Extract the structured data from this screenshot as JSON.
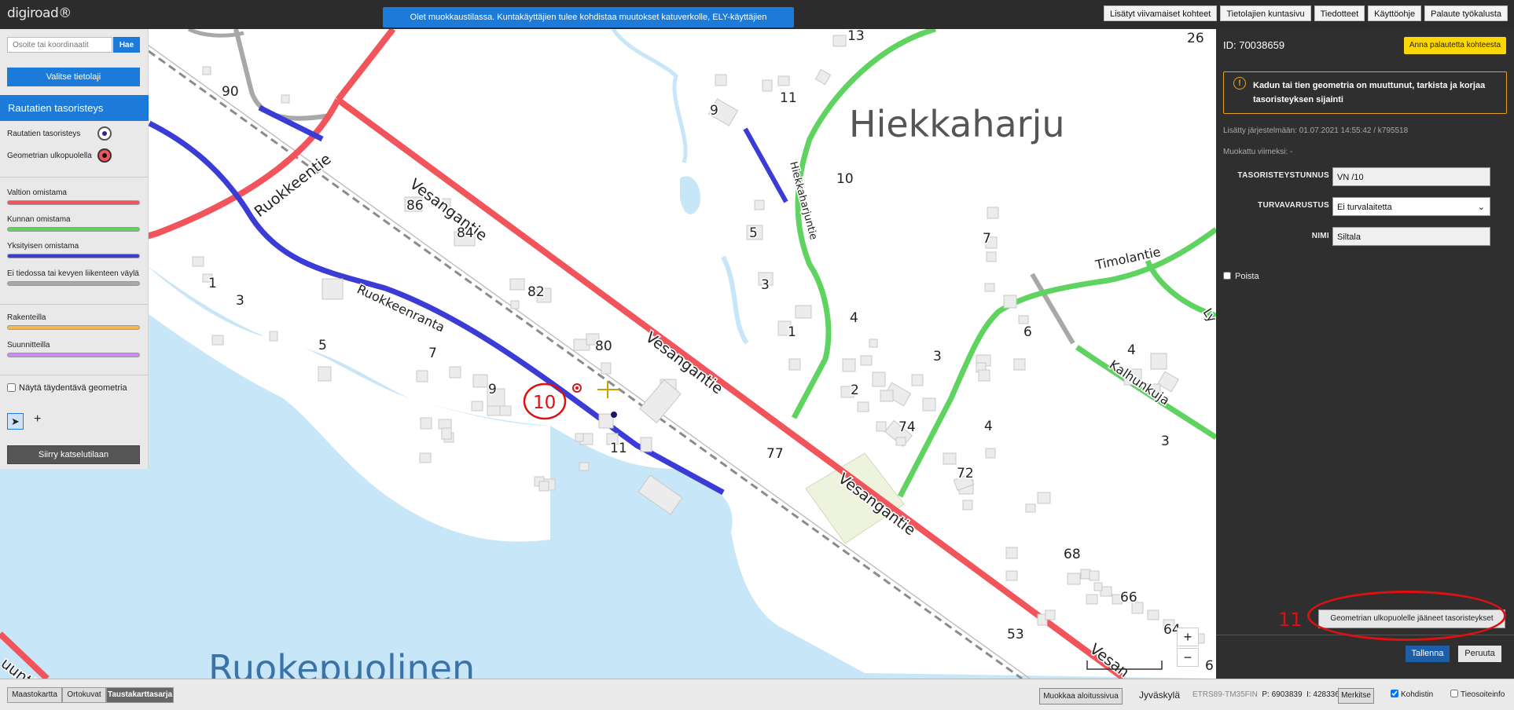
{
  "topbar": {
    "logo": "digiroad®",
    "banner": "Olet muokkaustilassa. Kuntakäyttäjien tulee kohdistaa muutokset katuverkolle, ELY-käyttäjien maantieverkolle.",
    "buttons": [
      "Lisätyt viivamaiset kohteet",
      "Tietolajien kuntasivu",
      "Tiedotteet",
      "Käyttöohje",
      "Palaute työkalusta"
    ]
  },
  "left_panel": {
    "search_placeholder": "Osoite tai koordinaatit",
    "search_button": "Hae",
    "select_layer_button": "Valitse tietolaji",
    "layer_title": "Rautatien tasoristeys",
    "legend_points": [
      {
        "label": "Rautatien tasoristeys",
        "color": "#2a2a8a"
      },
      {
        "label": "Geometrian ulkopuolella",
        "color": "#d41a1a"
      }
    ],
    "legend_lines": [
      {
        "label": "Valtion omistama",
        "color": "#f2545b"
      },
      {
        "label": "Kunnan omistama",
        "color": "#5fd35f"
      },
      {
        "label": "Yksityisen omistama",
        "color": "#3b3bd6"
      },
      {
        "label": "Ei tiedossa tai kevyen liikenteen väylä",
        "color": "#a8a8a8"
      },
      {
        "label": "Rakenteilla",
        "color": "#f6b84a"
      },
      {
        "label": "Suunnitteilla",
        "color": "#c88ef0"
      }
    ],
    "show_geometry_label": "Näytä täydentävä geometria",
    "view_mode_button": "Siirry katselutilaan"
  },
  "map": {
    "place_labels": {
      "hiekkaharju": "Hiekkaharju",
      "ruokepuolinen": "Ruokepuolinen"
    },
    "road_labels": {
      "vesangantie_1": "Vesangantie",
      "vesangantie_2": "Vesangantie",
      "vesangantie_3": "Vesangantie",
      "vesangantie_4": "Vesan",
      "ruokkeentie": "Ruokkeentie",
      "ruokkeenranta": "Ruokkeenranta",
      "hiekkaharjuntie": "Hiekkaharjuntie",
      "timolantie": "Timolantie",
      "kalhunkuja": "Kalhunkuja",
      "ly": "Ly",
      "uuntie": "uuntie"
    },
    "house_numbers": {
      "n13": "13",
      "n26": "26",
      "n90": "90",
      "n9a": "9",
      "n11a": "11",
      "n10a": "10",
      "n86": "86",
      "n84": "84",
      "n5a": "5",
      "n7a": "7",
      "n1a": "1",
      "n3a": "3",
      "n82": "82",
      "n3b": "3",
      "n5b": "5",
      "n7b": "7",
      "n80": "80",
      "n4a": "4",
      "n1b": "1",
      "n6": "6",
      "n4b": "4",
      "n3c": "3",
      "n9b": "9",
      "n2": "2",
      "n74": "74",
      "n4c": "4",
      "n3d": "3",
      "n11b": "11",
      "n77": "77",
      "n72": "72",
      "n68": "68",
      "n66": "66",
      "n64": "64",
      "n53": "53",
      "n6b": "6"
    },
    "annotation_10": "10",
    "zoom_in": "+",
    "zoom_out": "−"
  },
  "right_panel": {
    "id_label": "ID: 70038659",
    "feedback_button": "Anna palautetta kohteesta",
    "warning_icon": "!",
    "warning_text": "Kadun tai tien geometria on muuttunut, tarkista ja korjaa tasoristeyksen sijainti",
    "added": "Lisätty järjestelmään: 01.07.2021 14:55:42 / k795518",
    "modified": "Muokattu viimeksi: -",
    "fields": {
      "tunnus_label": "TASORISTEYSTUNNUS",
      "tunnus_value": "VN  /10",
      "turva_label": "TURVAVARUSTUS",
      "turva_value": "Ei turvalaitetta",
      "nimi_label": "NIMI",
      "nimi_value": "Siltala"
    },
    "poista_label": "Poista",
    "outside_button": "Geometrian ulkopuolelle jääneet tasoristeykset",
    "annotation_11": "11",
    "save_button": "Tallenna",
    "cancel_button": "Peruuta"
  },
  "bottombar": {
    "bg_tabs": [
      "Maastokartta",
      "Ortokuvat",
      "Taustakarttasarja"
    ],
    "active_tab": "Taustakarttasarja",
    "start_view_button": "Muokkaa aloitussivua",
    "city": "Jyväskylä",
    "crs": "ETRS89-TM35FIN",
    "coord_p": "P: 6903839",
    "coord_i": "I: 428336",
    "mark_button": "Merkitse",
    "crosshair_label": "Kohdistin",
    "roadinfo_label": "Tieosoiteinfo"
  },
  "colors": {
    "state_road": "#f2545b",
    "municipal_road": "#5fd35f",
    "private_road": "#3b3bd6",
    "unknown_road": "#a8a8a8",
    "water": "#c7e6f7",
    "accent": "#1c7ad8",
    "annotation": "#d11"
  }
}
